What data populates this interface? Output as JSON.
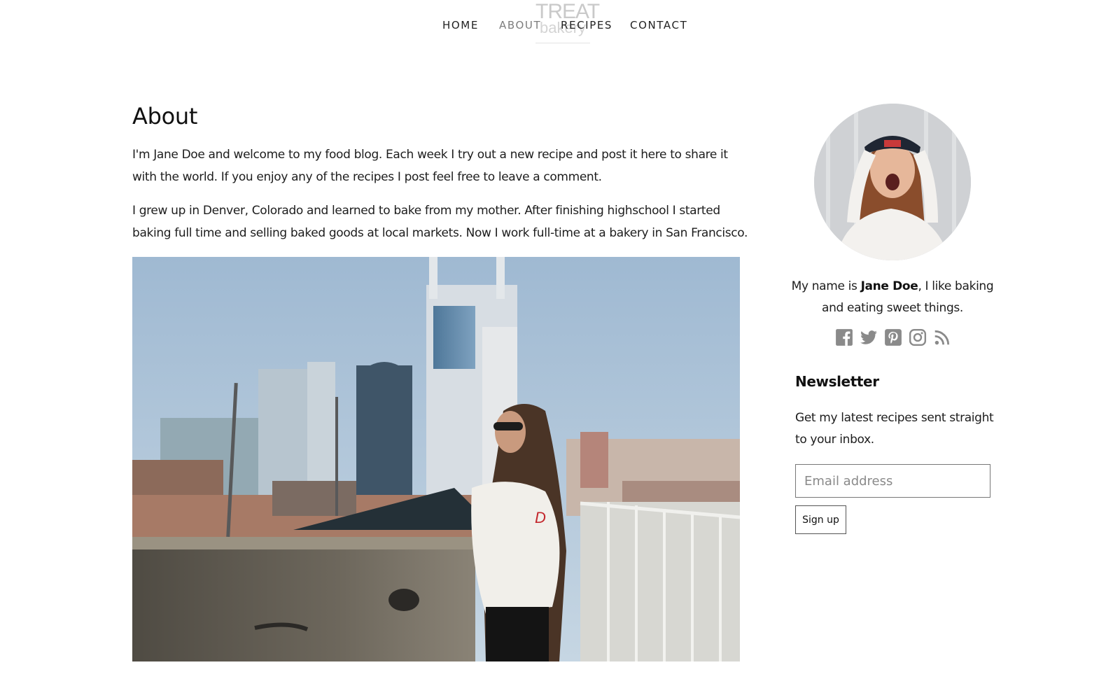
{
  "header": {
    "logo_top": "TREAT",
    "logo_bottom": "bakery",
    "nav": [
      {
        "label": "HOME",
        "active": false
      },
      {
        "label": "ABOUT",
        "active": true
      },
      {
        "label": "RECIPES",
        "active": false
      },
      {
        "label": "CONTACT",
        "active": false
      }
    ]
  },
  "main": {
    "title": "About",
    "paragraphs": [
      "I'm Jane Doe and welcome to my food blog. Each week I try out a new recipe and post it here to share it with the world. If you enjoy any of the recipes I post feel free to leave a comment.",
      "I grew up in Denver, Colorado and learned to bake from my mother. After finishing highschool I started baking full time and selling baked goods at local markets. Now I work full-time at a bakery in San Francisco."
    ]
  },
  "sidebar": {
    "bio_prefix": "My name is ",
    "bio_name": "Jane Doe",
    "bio_suffix": ", I like baking and eating sweet things.",
    "social_icons": [
      "facebook-icon",
      "twitter-icon",
      "pinterest-icon",
      "instagram-icon",
      "rss-icon"
    ],
    "newsletter": {
      "title": "Newsletter",
      "text": "Get my latest recipes sent straight to your inbox.",
      "email_placeholder": "Email address",
      "button_label": "Sign up"
    }
  },
  "colors": {
    "icon_gray": "#8a8a8a",
    "nav_active": "#7d7d7d",
    "text": "#1d1d1d"
  }
}
